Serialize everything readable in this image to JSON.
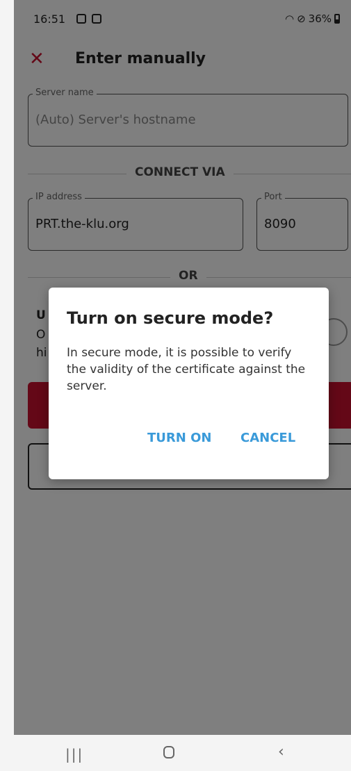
{
  "status_bar": {
    "time": "16:51",
    "battery": "36%"
  },
  "appbar": {
    "title": "Enter manually"
  },
  "server_name": {
    "label": "Server name",
    "placeholder": "(Auto) Server's hostname"
  },
  "connect_via": {
    "label": "CONNECT VIA"
  },
  "ip_address": {
    "label": "IP address",
    "value": "PRT.the-klu.org"
  },
  "port": {
    "label": "Port",
    "value": "8090"
  },
  "or_divider": {
    "label": "OR"
  },
  "dialog": {
    "title": "Turn on secure mode?",
    "body": "In secure mode, it is possible to verify the validity of the certificate against the server.",
    "turn_on": "TURN ON",
    "cancel": "CANCEL"
  },
  "colors": {
    "accent": "#c8102e",
    "dialog_button": "#3a9ad9"
  }
}
